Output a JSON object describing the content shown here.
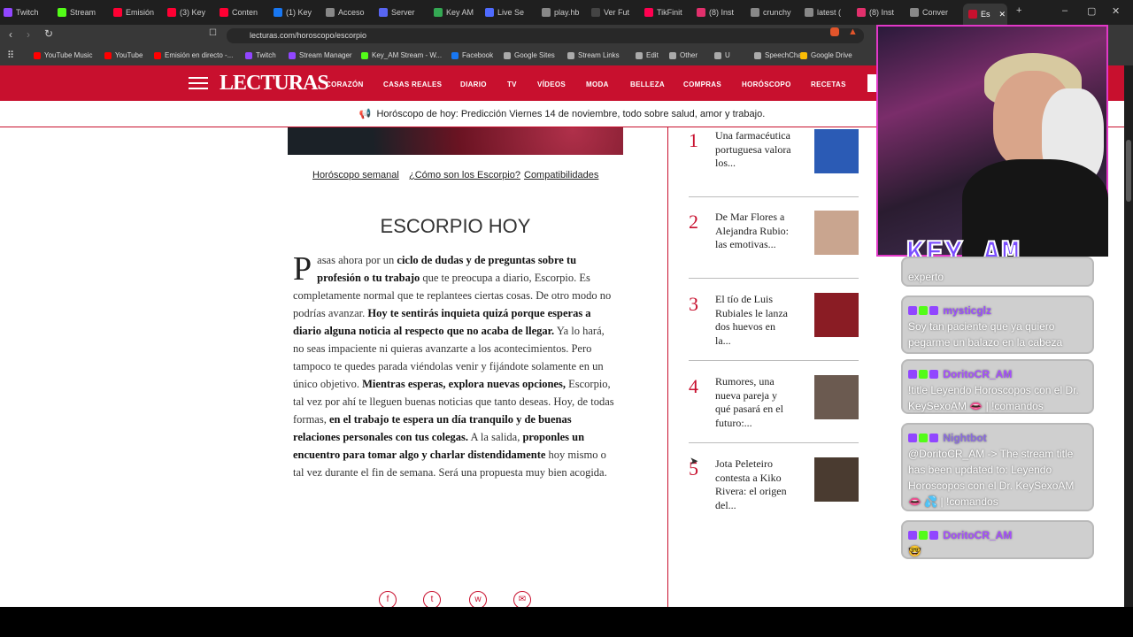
{
  "browser": {
    "tabs": [
      {
        "label": "Twitch",
        "color": "#9146ff"
      },
      {
        "label": "Stream",
        "color": "#53fc18"
      },
      {
        "label": "Emisión",
        "color": "#ff0033"
      },
      {
        "label": "(3) Key",
        "color": "#ff0033"
      },
      {
        "label": "Conten",
        "color": "#ff0033"
      },
      {
        "label": "(1) Key",
        "color": "#1877f2"
      },
      {
        "label": "Acceso",
        "color": "#888888"
      },
      {
        "label": "Server",
        "color": "#5865f2"
      },
      {
        "label": "Key AM",
        "color": "#34a853"
      },
      {
        "label": "Live Se",
        "color": "#4f6bff"
      },
      {
        "label": "play.hb",
        "color": "#888888"
      },
      {
        "label": "Ver Fut",
        "color": "#444444"
      },
      {
        "label": "TikFinit",
        "color": "#ff0050"
      },
      {
        "label": "(8) Inst",
        "color": "#e1306c"
      },
      {
        "label": "crunchy",
        "color": "#888888"
      },
      {
        "label": "latest (",
        "color": "#888888"
      },
      {
        "label": "(8) Inst",
        "color": "#e1306c"
      },
      {
        "label": "Conver",
        "color": "#888888"
      },
      {
        "label": "Es",
        "color": "#c8102e",
        "active": true
      }
    ],
    "url": "lecturas.com/horoscopo/escorpio",
    "bookmarks": [
      {
        "label": "YouTube Music",
        "color": "#ff0000"
      },
      {
        "label": "YouTube",
        "color": "#ff0000"
      },
      {
        "label": "Emisión en directo -...",
        "color": "#ff0000"
      },
      {
        "label": "Twitch",
        "color": "#9146ff"
      },
      {
        "label": "Stream Manager",
        "color": "#9146ff"
      },
      {
        "label": "Key_AM Stream - W...",
        "color": "#53fc18"
      },
      {
        "label": "Facebook",
        "color": "#1877f2"
      },
      {
        "label": "Google Sites",
        "color": "#aaaaaa"
      },
      {
        "label": "Stream Links",
        "color": "#aaaaaa"
      },
      {
        "label": "Edit",
        "color": "#aaaaaa"
      },
      {
        "label": "Other",
        "color": "#aaaaaa"
      },
      {
        "label": "U",
        "color": "#aaaaaa"
      },
      {
        "label": "SpeechChat",
        "color": "#aaaaaa"
      },
      {
        "label": "Google Drive",
        "color": "#fbbc04"
      }
    ]
  },
  "site": {
    "logo": "LECTURAS",
    "menu": [
      "CORAZÓN",
      "CASAS REALES",
      "DIARIO",
      "TV",
      "VÍDEOS",
      "MODA",
      "BELLEZA",
      "COMPRAS",
      "HORÓSCOPO",
      "RECETAS"
    ],
    "ticker": "Horóscopo de hoy: Predicción Viernes 14 de noviembre, todo sobre salud, amor y trabajo.",
    "sublinks": [
      "Horóscopo semanal",
      "¿Cómo son los Escorpio?",
      "Compatibilidades"
    ],
    "heading": "ESCORPIO HOY"
  },
  "ranking": [
    {
      "num": "1",
      "title": "Una farmacéutica portuguesa valora los...",
      "thumb": "#2b5bb5"
    },
    {
      "num": "2",
      "title": "De Mar Flores a Alejandra Rubio: las emotivas...",
      "thumb": "#c9a58f"
    },
    {
      "num": "3",
      "title": "El tío de Luis Rubiales le lanza dos huevos en la...",
      "thumb": "#8a1c24"
    },
    {
      "num": "4",
      "title": "Rumores, una nueva pareja y qué pasará en el futuro:...",
      "thumb": "#6b5a50"
    },
    {
      "num": "5",
      "title": "Jota Peleteiro contesta a Kiko Rivera: el origen del...",
      "thumb": "#4a3b30"
    }
  ],
  "stream": {
    "overlay_text": "KEY_AM",
    "chat": [
      {
        "user": "",
        "text": "experto",
        "partial": true
      },
      {
        "user": "mysticglz",
        "user_color": "#9c4dff",
        "text": "Soy tan paciente que ya quiero pegarme un balazo en la cabeza"
      },
      {
        "user": "DoritoCR_AM",
        "user_color": "#a64dff",
        "text": "!title Leyendo Horoscopos con el Dr. KeySexoAM 👄 | !comandos"
      },
      {
        "user": "Nightbot",
        "user_color": "#8a6be0",
        "text": "@DoritoCR_AM -> The stream title has been updated to: Leyendo Horoscopos con el Dr. KeySexoAM 👄 💦 | !comandos"
      },
      {
        "user": "DoritoCR_AM",
        "user_color": "#a64dff",
        "text": "🤓"
      }
    ]
  }
}
